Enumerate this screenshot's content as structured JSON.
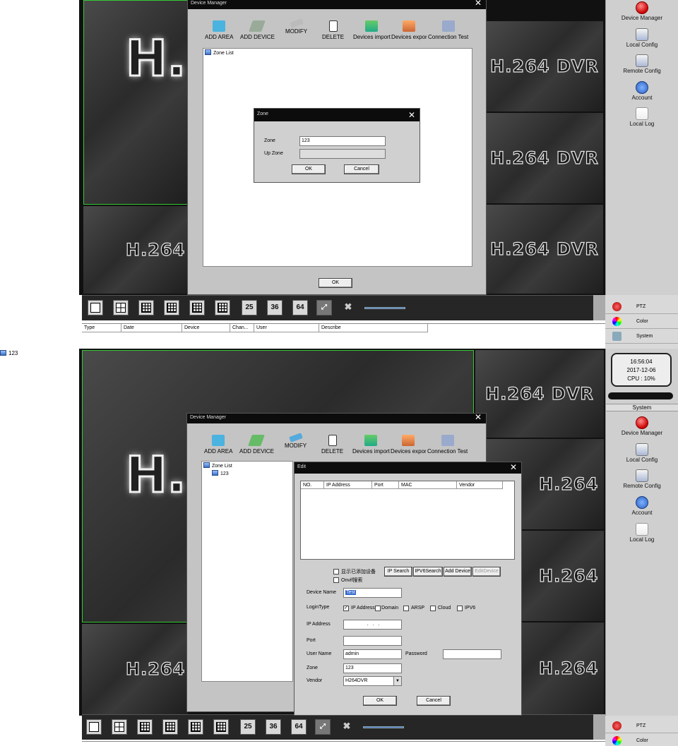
{
  "panel1": {
    "dvr_labels": [
      "H.264 DVR",
      "H.264 DVR",
      "H.264 DVR",
      "H.264 DVR"
    ],
    "big_h": "H.",
    "device_manager": {
      "title": "Device Manager",
      "tools": [
        "ADD AREA",
        "ADD DEVICE",
        "MODIFY",
        "DELETE",
        "Devices import",
        "Devices export",
        "Connection Test"
      ],
      "zone_list_root": "Zone List",
      "ok_label": "OK"
    },
    "zone_dialog": {
      "title": "Zone",
      "zone_label": "Zone",
      "zone_value": "123",
      "up_zone_label": "Up Zone",
      "up_zone_value": "",
      "ok_label": "OK",
      "cancel_label": "Cancel"
    },
    "sidebar": [
      "Device Manager",
      "Local Config",
      "Remote Config",
      "Account",
      "Local Log"
    ],
    "toolbar_buttons": [
      "25",
      "36",
      "64"
    ],
    "right_controls": [
      "PTZ",
      "Color",
      "System"
    ],
    "log_headers": [
      "Type",
      "Date",
      "Device",
      "Chan...",
      "User",
      "Describe"
    ],
    "left_item": "123"
  },
  "panel2": {
    "dvr_labels": [
      "H.264 DVR",
      "H.264 DVR",
      "H.264 DVR",
      "H.264 DVR"
    ],
    "big_h": "H.",
    "clock": {
      "time": "16:56:04",
      "date": "2017-12-06",
      "cpu": "CPU : 10%"
    },
    "system_title": "System",
    "sidebar": [
      "Device Manager",
      "Local Config",
      "Remote Config",
      "Account",
      "Local Log"
    ],
    "device_manager": {
      "title": "Device Manager",
      "tools": [
        "ADD AREA",
        "ADD DEVICE",
        "MODIFY",
        "DELETE",
        "Devices import",
        "Devices export",
        "Connection Test"
      ],
      "zone_list_root": "Zone List",
      "zone_child": "123"
    },
    "edit_dialog": {
      "title": "Edit",
      "columns": [
        "NO.",
        "IP Address",
        "Port",
        "MAC",
        "Vendor"
      ],
      "show_added": "显示已添加设备",
      "onvif_search": "Onvif搜索",
      "btn_ip_search": "IP Search",
      "btn_ipv6_search": "IPV6Search",
      "btn_add_device": "Add Device",
      "btn_edit_device": "EditDevice",
      "device_name_label": "Device Name",
      "device_name_value": "Test",
      "login_type_label": "LoginType",
      "login_types": [
        "IP Address",
        "Domain",
        "ARSP",
        "Cloud",
        "IPV6"
      ],
      "ip_label": "IP Address",
      "ip_value": ".   .   .",
      "port_label": "Port",
      "port_value": "",
      "user_label": "User Name",
      "user_value": "admin",
      "password_label": "Password",
      "password_value": "",
      "zone_label": "Zone",
      "zone_value": "123",
      "vendor_label": "Vendor",
      "vendor_value": "H264DVR",
      "ok_label": "OK",
      "cancel_label": "Cancel"
    },
    "toolbar_buttons": [
      "25",
      "36",
      "64"
    ],
    "right_controls": [
      "PTZ",
      "Color"
    ]
  }
}
